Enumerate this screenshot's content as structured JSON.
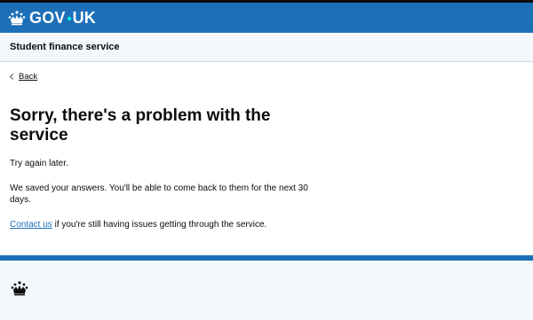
{
  "header": {
    "logo_text_left": "GOV",
    "logo_text_right": "UK",
    "crown_icon": "crown-icon"
  },
  "service": {
    "name": "Student finance service"
  },
  "main": {
    "back_label": "Back",
    "heading": "Sorry, there's a problem with the service",
    "para_try_again": "Try again later.",
    "para_saved": "We saved your answers. You'll be able to come back to them for the next 30 days.",
    "contact_link": "Contact us",
    "contact_rest": " if you're still having issues getting through the service."
  },
  "footer": {
    "crown_icon": "crown-icon"
  },
  "colors": {
    "header_blue": "#1d70b8",
    "dot_teal": "#00ffe0",
    "service_bar_bg": "#f4f8fb",
    "text": "#0b0c0c",
    "link": "#1d70b8"
  }
}
